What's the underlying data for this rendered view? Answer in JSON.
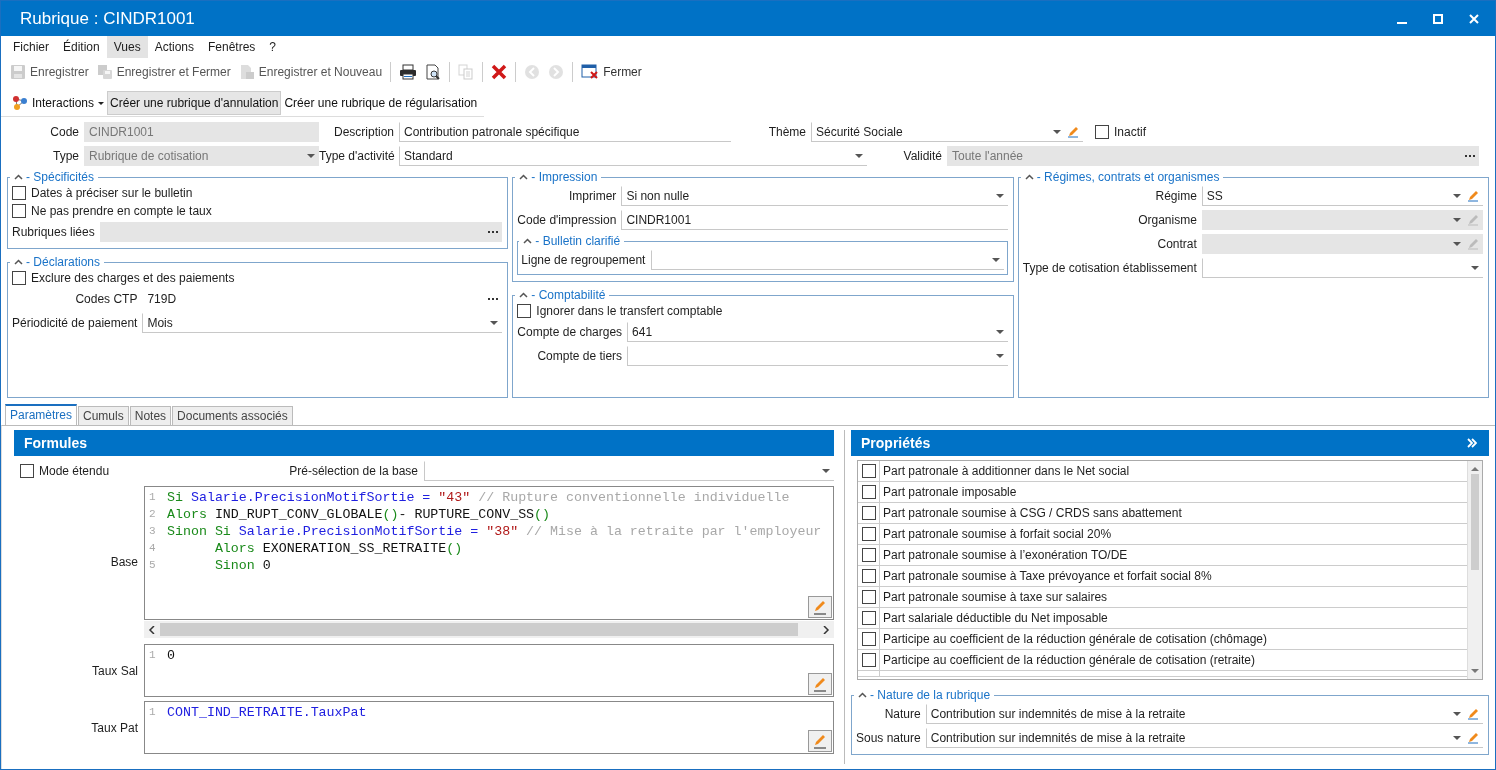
{
  "window": {
    "title": "Rubrique : CINDR1001"
  },
  "menu": [
    {
      "label": "Fichier",
      "selected": false
    },
    {
      "label": "Édition",
      "selected": false
    },
    {
      "label": "Vues",
      "selected": true
    },
    {
      "label": "Actions",
      "selected": false
    },
    {
      "label": "Fenêtres",
      "selected": false
    },
    {
      "label": "?",
      "selected": false
    }
  ],
  "toolbar": [
    [
      {
        "kind": "save",
        "label": "Enregistrer",
        "disabled": true
      },
      {
        "kind": "save-close",
        "label": "Enregistrer et Fermer",
        "disabled": true
      },
      {
        "kind": "save-new",
        "label": "Enregistrer et Nouveau",
        "disabled": true
      }
    ],
    [
      {
        "kind": "print",
        "disabled": false
      },
      {
        "kind": "preview",
        "disabled": false
      }
    ],
    [
      {
        "kind": "copy",
        "disabled": true
      }
    ],
    [
      {
        "kind": "delete",
        "disabled": false
      }
    ],
    [
      {
        "kind": "back",
        "disabled": true
      },
      {
        "kind": "forward",
        "disabled": true
      }
    ],
    [
      {
        "kind": "close",
        "label": "Fermer",
        "disabled": false
      }
    ]
  ],
  "actions": {
    "interactions": "Interactions",
    "buttons": [
      {
        "label": "Créer une rubrique d'annulation",
        "selected": true
      },
      {
        "label": "Créer une rubrique de régularisation",
        "selected": false
      }
    ]
  },
  "header": [
    [
      {
        "kind": "text",
        "label": "Code",
        "value": "CINDR1001",
        "disabled": true
      },
      {
        "kind": "text",
        "label": "Description",
        "value": "Contribution patronale spécifique",
        "disabled": false
      },
      {
        "kind": "select",
        "label": "Thème",
        "value": "Sécurité Sociale",
        "disabled": false,
        "editable": true
      },
      {
        "kind": "checkbox",
        "label": "Inactif",
        "checked": false
      }
    ],
    [
      {
        "kind": "select",
        "label": "Type",
        "value": "Rubrique de cotisation",
        "disabled": true
      },
      {
        "kind": "select",
        "label": "Type d'activité",
        "value": "Standard",
        "disabled": false
      },
      {
        "kind": "ellipsis",
        "label": "Validité",
        "value": "Toute l'année",
        "disabled": true
      }
    ]
  ],
  "groups": [
    [
      {
        "title": "- Spécificités",
        "items": [
          {
            "kind": "checkbox",
            "label": "Dates à préciser sur le bulletin",
            "checked": false
          },
          {
            "kind": "checkbox",
            "label": "Ne pas prendre en compte le taux",
            "checked": false
          },
          {
            "kind": "ellipsis",
            "label": "Rubriques liées",
            "disabled": true
          }
        ]
      },
      {
        "title": "- Déclarations",
        "items": [
          {
            "kind": "checkbox",
            "label": "Exclure des charges et des paiements",
            "checked": false
          },
          {
            "kind": "ellipsis",
            "label": "Codes CTP",
            "value": "719D",
            "disabled": false,
            "bare": true
          },
          {
            "kind": "select",
            "label": "Périodicité de paiement",
            "value": "Mois",
            "disabled": false
          }
        ]
      }
    ],
    [
      {
        "title": "- Impression",
        "items": [
          {
            "kind": "select",
            "label": "Imprimer",
            "value": "Si non nulle",
            "disabled": false
          },
          {
            "kind": "text",
            "label": "Code d'impression",
            "value": "CINDR1001",
            "disabled": false
          },
          {
            "kind": "group",
            "title": "- Bulletin clarifié",
            "items": [
              {
                "kind": "select",
                "label": "Ligne de regroupement",
                "disabled": false
              }
            ]
          }
        ]
      },
      {
        "title": "- Comptabilité",
        "items": [
          {
            "kind": "checkbox",
            "label": "Ignorer dans le transfert comptable",
            "checked": false
          },
          {
            "kind": "select",
            "label": "Compte de charges",
            "value": "641",
            "disabled": false
          },
          {
            "kind": "select",
            "label": "Compte de tiers",
            "disabled": false
          }
        ]
      }
    ],
    [
      {
        "title": "- Régimes, contrats et organismes",
        "items": [
          {
            "kind": "select",
            "label": "Régime",
            "value": "SS",
            "disabled": false,
            "editable": true
          },
          {
            "kind": "select",
            "label": "Organisme",
            "disabled": true,
            "editable": true
          },
          {
            "kind": "select",
            "label": "Contrat",
            "disabled": true,
            "editable": true
          },
          {
            "kind": "select",
            "label": "Type de cotisation établissement",
            "disabled": false
          }
        ]
      }
    ]
  ],
  "tabs": [
    {
      "label": "Paramètres",
      "selected": true
    },
    {
      "label": "Cumuls",
      "selected": false
    },
    {
      "label": "Notes",
      "selected": false
    },
    {
      "label": "Documents associés",
      "selected": false
    }
  ],
  "formules": {
    "title": "Formules",
    "mode_etendu": {
      "label": "Mode étendu",
      "checked": false
    },
    "preselection": {
      "kind": "select",
      "label": "Pré-sélection de la base",
      "disabled": false
    },
    "editors": [
      {
        "label": "Base",
        "hscroll": true,
        "lines": [
          {
            "number": "1",
            "tokens": [
              {
                "kind": "keyword",
                "text": "Si "
              },
              {
                "kind": "variable",
                "text": "Salarie.PrecisionMotifSortie = "
              },
              {
                "kind": "string",
                "text": "\"43\""
              },
              {
                "kind": "comment",
                "text": " // Rupture conventionnelle individuelle"
              }
            ]
          },
          {
            "number": "2",
            "tokens": [
              {
                "kind": "keyword",
                "text": "Alors "
              },
              {
                "kind": "plain",
                "text": "IND_RUPT_CONV_GLOBALE"
              },
              {
                "kind": "keyword",
                "text": "()"
              },
              {
                "kind": "plain",
                "text": "- RUPTURE_CONV_SS"
              },
              {
                "kind": "keyword",
                "text": "()"
              }
            ]
          },
          {
            "number": "3",
            "tokens": [
              {
                "kind": "keyword",
                "text": "Sinon Si "
              },
              {
                "kind": "variable",
                "text": "Salarie.PrecisionMotifSortie = "
              },
              {
                "kind": "string",
                "text": "\"38\""
              },
              {
                "kind": "comment",
                "text": " // Mise à la retraite par l'employeur"
              }
            ]
          },
          {
            "number": "4",
            "tokens": [
              {
                "kind": "keyword",
                "text": "      Alors "
              },
              {
                "kind": "plain",
                "text": "EXONERATION_SS_RETRAITE"
              },
              {
                "kind": "keyword",
                "text": "()"
              }
            ]
          },
          {
            "number": "5",
            "tokens": [
              {
                "kind": "keyword",
                "text": "      Sinon "
              },
              {
                "kind": "plain",
                "text": "0"
              }
            ]
          }
        ]
      },
      {
        "label": "Taux Sal",
        "hscroll": false,
        "lines": [
          {
            "number": "1",
            "tokens": [
              {
                "kind": "plain",
                "text": "0"
              }
            ]
          }
        ]
      },
      {
        "label": "Taux Pat",
        "hscroll": false,
        "lines": [
          {
            "number": "1",
            "tokens": [
              {
                "kind": "variable",
                "text": "CONT_IND_RETRAITE.TauxPat"
              }
            ]
          }
        ]
      }
    ]
  },
  "proprietes": {
    "title": "Propriétés",
    "items": [
      {
        "label": "Part patronale à additionner dans le Net social",
        "checked": false
      },
      {
        "label": "Part patronale imposable",
        "checked": false
      },
      {
        "label": "Part patronale soumise à CSG / CRDS sans abattement",
        "checked": false
      },
      {
        "label": "Part patronale soumise à forfait social 20%",
        "checked": false
      },
      {
        "label": "Part patronale soumise à l’exonération TO/DE",
        "checked": false
      },
      {
        "label": "Part patronale soumise à Taxe prévoyance et forfait social 8%",
        "checked": false
      },
      {
        "label": "Part patronale soumise à taxe sur salaires",
        "checked": false
      },
      {
        "label": "Part salariale déductible du Net imposable",
        "checked": false
      },
      {
        "label": "Participe au coefficient de la réduction générale de cotisation (chômage)",
        "checked": false
      },
      {
        "label": "Participe au coefficient de la réduction générale de cotisation (retraite)",
        "checked": false
      }
    ],
    "nature": {
      "title": "- Nature de la rubrique",
      "items": [
        {
          "kind": "select",
          "label": "Nature",
          "value": "Contribution sur indemnités de mise à la retraite",
          "disabled": false,
          "editable": true
        },
        {
          "kind": "select",
          "label": "Sous nature",
          "value": "Contribution sur indemnités de mise à la retraite",
          "disabled": false,
          "editable": true
        }
      ]
    }
  }
}
